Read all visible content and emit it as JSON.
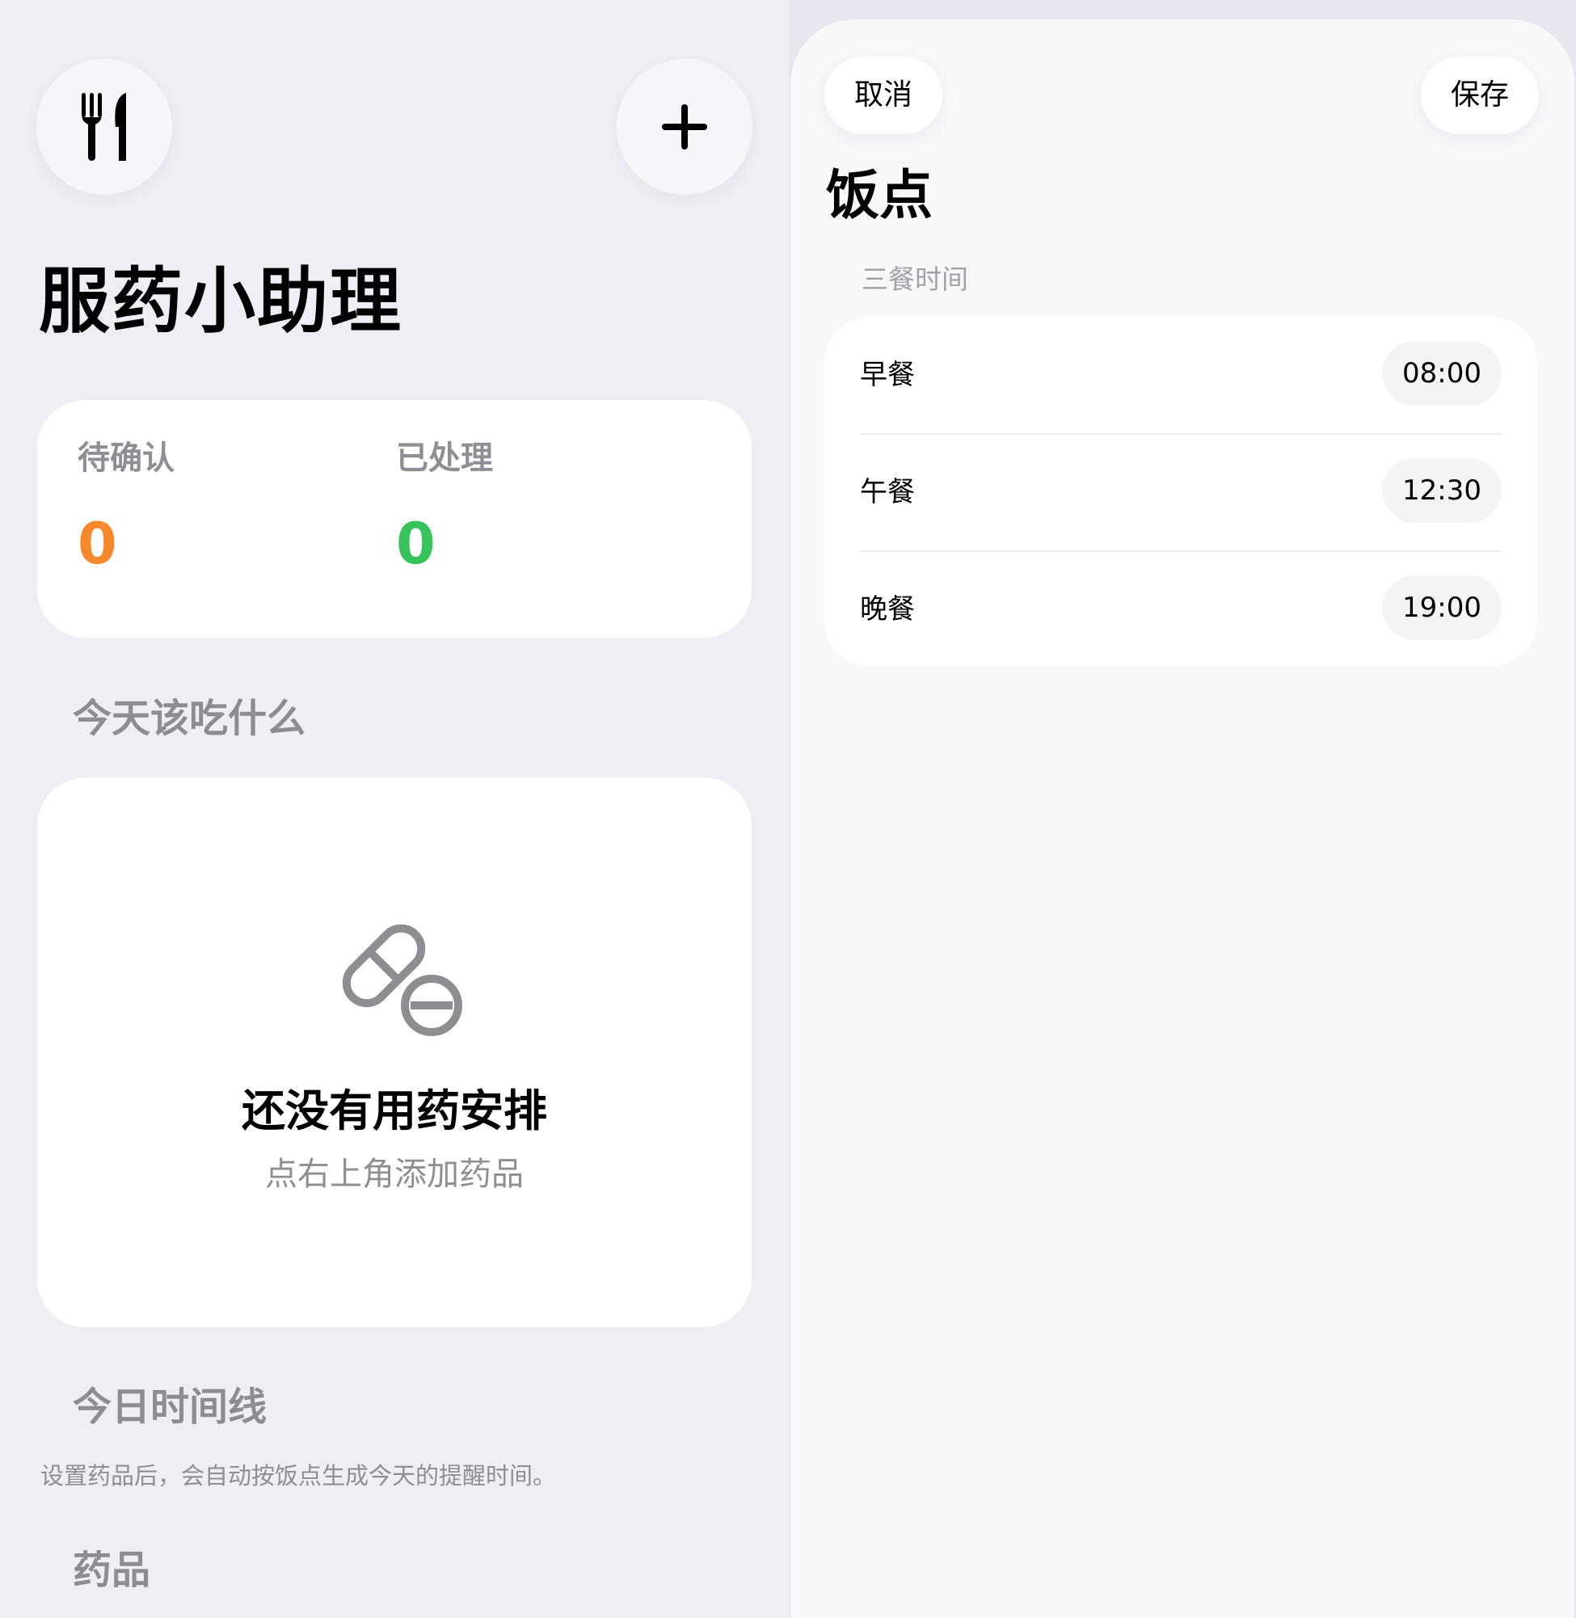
{
  "main": {
    "title": "服药小助理",
    "header_buttons": {
      "left_icon": "fork-knife-icon",
      "right_icon": "plus-icon"
    },
    "stats": {
      "pending_label": "待确认",
      "pending_value": "0",
      "handled_label": "已处理",
      "handled_value": "0"
    },
    "today_section": {
      "title": "今天该吃什么",
      "empty_icon": "pills-icon",
      "empty_title": "还没有用药安排",
      "empty_subtitle": "点右上角添加药品"
    },
    "timeline_section": {
      "title": "今日时间线",
      "note": "设置药品后，会自动按饭点生成今天的提醒时间。"
    },
    "medicines_section": {
      "title": "药品"
    }
  },
  "sheet": {
    "cancel_label": "取消",
    "save_label": "保存",
    "title": "饭点",
    "section_label": "三餐时间",
    "meals": [
      {
        "name": "早餐",
        "time": "08:00"
      },
      {
        "name": "午餐",
        "time": "12:30"
      },
      {
        "name": "晚餐",
        "time": "19:00"
      }
    ]
  },
  "colors": {
    "pending": "#f7892c",
    "handled": "#35c35a",
    "background": "#eeeff5",
    "card": "#ffffff",
    "secondary_text": "#8e8e94"
  }
}
